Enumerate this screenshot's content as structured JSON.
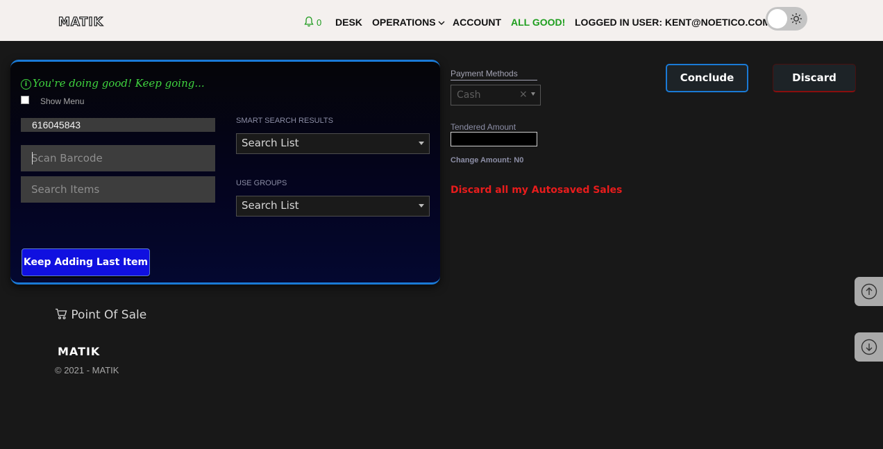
{
  "header": {
    "logo": "MATIK",
    "notification_count": "0",
    "nav": {
      "desk": "DESK",
      "operations": "OPERATIONS",
      "account": "ACCOUNT",
      "status": "ALL GOOD!",
      "logged_in": "LOGGED IN USER: KENT@NOETICO.COM"
    }
  },
  "pos_panel": {
    "message": "You're doing good! Keep going...",
    "show_menu_label": "Show Menu",
    "barcode_value": "616045843",
    "scan_placeholder": "Scan Barcode",
    "search_items_placeholder": "Search Items",
    "smart_search_label": "SMART SEARCH RESULTS",
    "smart_search_value": "Search List",
    "use_groups_label": "USE GROUPS",
    "use_groups_value": "Search List",
    "keep_adding_button": "Keep Adding Last Item"
  },
  "payment": {
    "methods_label": "Payment Methods",
    "method_value": "Cash",
    "clear_symbol": "×",
    "tendered_label": "Tendered Amount",
    "change_amount": "Change Amount: N0",
    "discard_autosaved": "Discard all my Autosaved Sales"
  },
  "actions": {
    "conclude": "Conclude",
    "discard": "Discard"
  },
  "footer": {
    "pos_link": "Point Of Sale",
    "logo": "MATIK",
    "copyright": "© 2021 - MATIK"
  },
  "colors": {
    "accent_blue": "#1a7ad6",
    "success_green": "#1f9b1f",
    "danger_red": "#e81c1c",
    "button_blue": "#1010e0"
  },
  "icons": [
    "bell-icon",
    "chevron-down-icon",
    "sun-icon",
    "info-icon",
    "cart-icon",
    "arrow-up-circle-icon",
    "arrow-down-circle-icon"
  ]
}
